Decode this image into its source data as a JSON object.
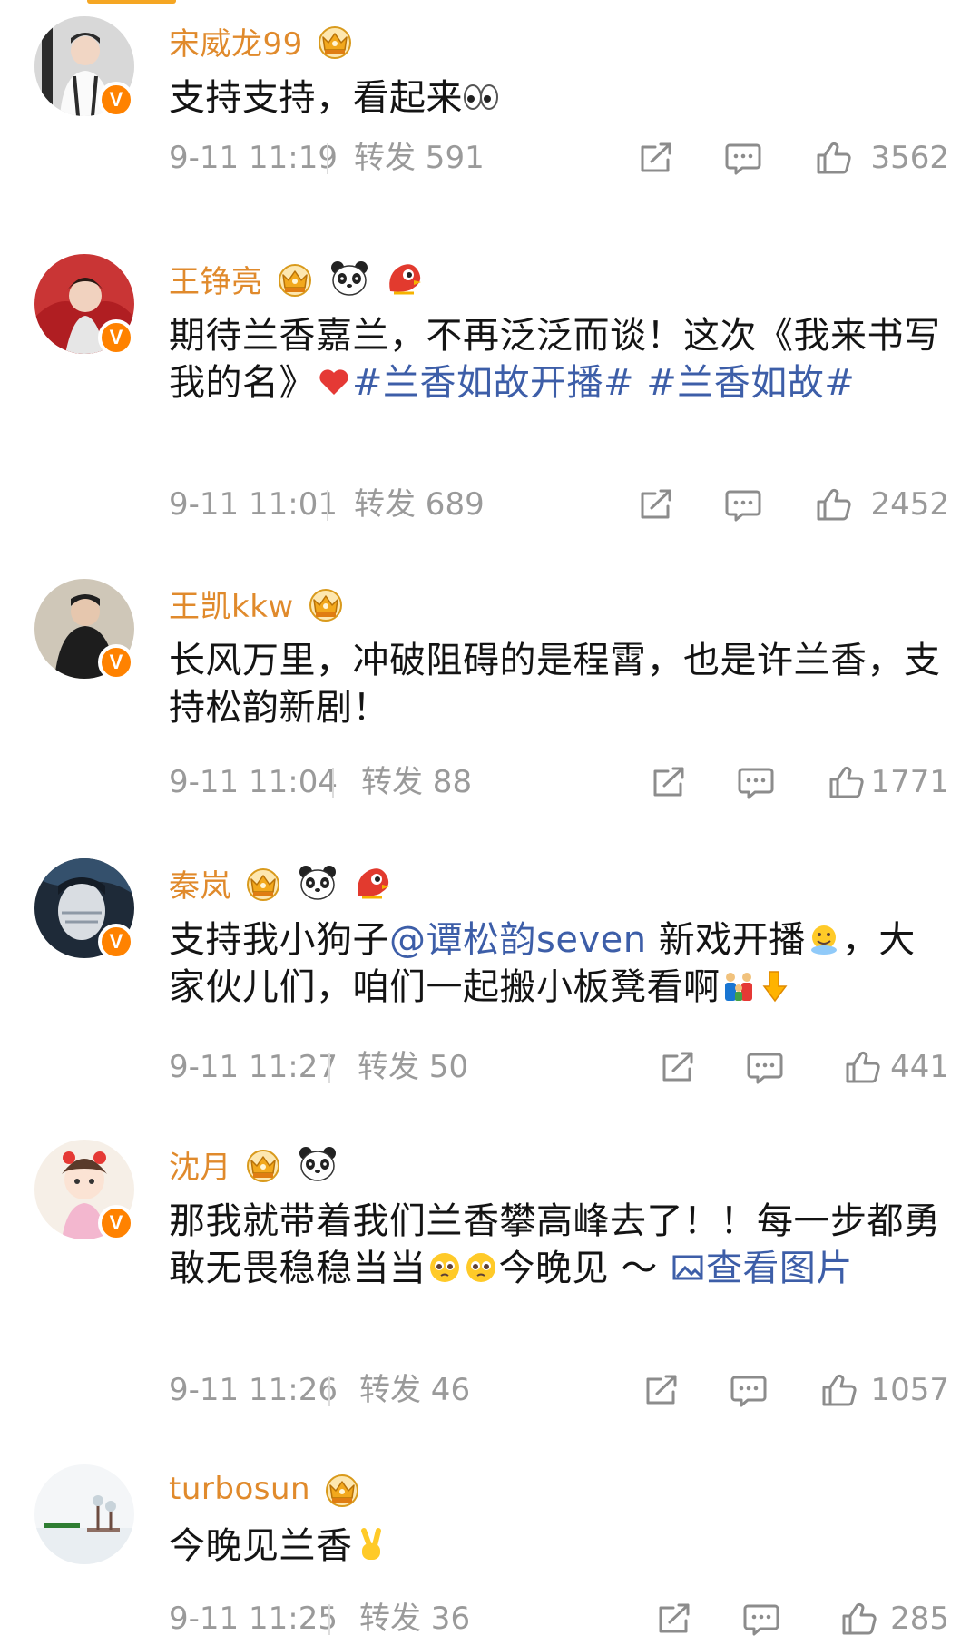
{
  "comments": [
    {
      "username": "宋威龙99",
      "text_parts": [
        "支持支持，看起来",
        "👀"
      ],
      "time": "9-11 11:19",
      "forward": "转发 591",
      "likes": "3562"
    },
    {
      "username": "王铮亮",
      "text_parts": [
        "期待兰香嘉兰，不再泛泛而谈！这次《我来书写我的名》",
        "❤️",
        "#兰香如故开播#",
        " ",
        "#兰香如故#"
      ],
      "time": "9-11 11:01",
      "forward": "转发 689",
      "likes": "2452"
    },
    {
      "username": "王凯kkw",
      "text_parts": [
        "长风万里，冲破阻碍的是程霄，也是许兰香，支持松韵新剧！"
      ],
      "time": "9-11 11:04",
      "forward": "转发 88",
      "likes": "1771"
    },
    {
      "username": "秦岚",
      "text_parts": [
        "支持我小狗子",
        "@谭松韵seven",
        " 新戏开播",
        "，大家伙儿们，咱们一起搬小板凳看啊"
      ],
      "time": "9-11 11:27",
      "forward": "转发 50",
      "likes": "441"
    },
    {
      "username": "沈月",
      "text_parts": [
        "那我就带着我们兰香攀高峰去了！！每一步都勇敢无畏稳稳当当",
        "今晚见 ～ ",
        "查看图片"
      ],
      "time": "9-11 11:26",
      "forward": "转发 46",
      "likes": "1057"
    },
    {
      "username": "turbosun",
      "text_parts": [
        "今晚见兰香",
        "✌️"
      ],
      "time": "9-11 11:25",
      "forward": "转发 36",
      "likes": "285"
    }
  ],
  "verified_mark": "V",
  "colors": {
    "username": "#e08a2c",
    "link": "#3d5ea8",
    "meta": "#9a9a9a",
    "verified": "#ff8200"
  },
  "icons": [
    "share-icon",
    "comment-icon",
    "like-icon",
    "crown-badge-icon",
    "panda-badge-icon",
    "mascot-badge-icon",
    "verified-icon"
  ]
}
